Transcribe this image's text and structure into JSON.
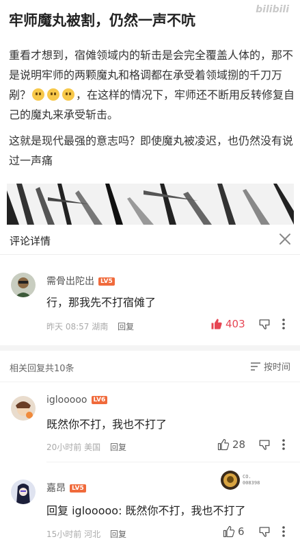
{
  "post": {
    "title": "牢师魔丸被割，仍然一声不吭",
    "watermark": "bilibili",
    "paragraph1_a": "重看才想到，宿傩领域内的斩击是会完全覆盖人体的，那不是说明牢师的两颗魔丸和格调都在承受着领域捌的千刀万剐？",
    "paragraph1_b": "，在这样的情况下，牢师还不断用反转修复自己的魔丸来承受斩击。",
    "paragraph2": "这就是现代最强的意志吗？即使魔丸被凌迟，也仍然没有说过一声痛"
  },
  "sheet": {
    "title": "评论详情"
  },
  "main_comment": {
    "username": "需骨出陀出",
    "level": "LV5",
    "text": "行，那我先不打宿傩了",
    "time": "昨天 08:57",
    "location": "湖南",
    "reply_label": "回复",
    "likes": "403"
  },
  "replies_header": {
    "count_text": "相关回复共10条",
    "sort_label": "按时间"
  },
  "replies": [
    {
      "username": "iglooooo",
      "level": "LV6",
      "text": "既然你不打，我也不打了",
      "time": "20小时前",
      "location": "美国",
      "reply_label": "回复",
      "likes": "28"
    },
    {
      "username": "嘉昂",
      "level": "LV5",
      "text": "回复 iglooooo: 既然你不打，我也不打了",
      "time": "15小时前",
      "location": "河北",
      "reply_label": "回复",
      "likes": "6",
      "badge_line1": "CO.",
      "badge_line2": "008398"
    }
  ],
  "colors": {
    "accent_red": "#e64553",
    "level_orange": "#f06a3b"
  }
}
